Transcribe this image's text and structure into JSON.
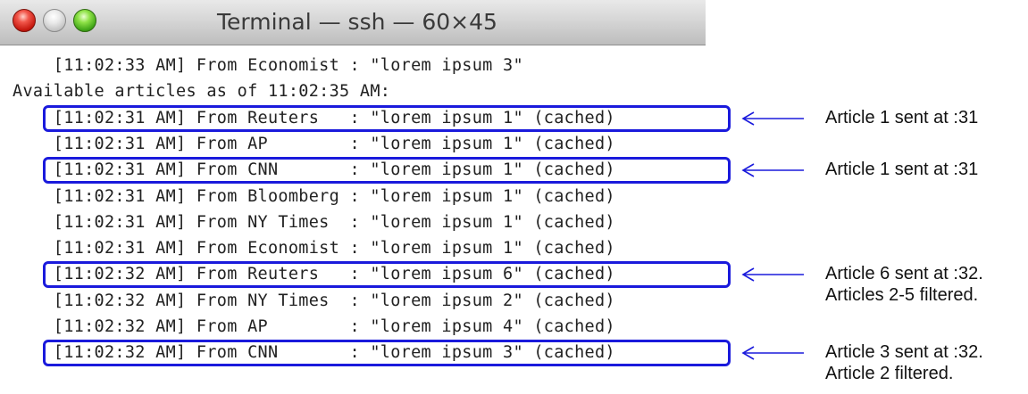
{
  "window": {
    "title": "Terminal — ssh — 60×45",
    "controls": [
      "close-button",
      "minimize-button",
      "zoom-button"
    ]
  },
  "terminal": {
    "lines": [
      "    [11:02:33 AM] From Economist : \"lorem ipsum 3\"",
      "Available articles as of 11:02:35 AM:",
      "    [11:02:31 AM] From Reuters   : \"lorem ipsum 1\" (cached)",
      "    [11:02:31 AM] From AP        : \"lorem ipsum 1\" (cached)",
      "    [11:02:31 AM] From CNN       : \"lorem ipsum 1\" (cached)",
      "    [11:02:31 AM] From Bloomberg : \"lorem ipsum 1\" (cached)",
      "    [11:02:31 AM] From NY Times  : \"lorem ipsum 1\" (cached)",
      "    [11:02:31 AM] From Economist : \"lorem ipsum 1\" (cached)",
      "    [11:02:32 AM] From Reuters   : \"lorem ipsum 6\" (cached)",
      "    [11:02:32 AM] From NY Times  : \"lorem ipsum 2\" (cached)",
      "    [11:02:32 AM] From AP        : \"lorem ipsum 4\" (cached)",
      "    [11:02:32 AM] From CNN       : \"lorem ipsum 3\" (cached)"
    ]
  },
  "annotations": [
    {
      "line": 2,
      "text": "Article 1 sent at :31"
    },
    {
      "line": 4,
      "text": "Article 1 sent at :31"
    },
    {
      "line": 8,
      "text": "Article 6 sent at :32.\nArticles 2-5 filtered."
    },
    {
      "line": 11,
      "text": "Article 3 sent at :32.\nArticle 2 filtered."
    }
  ],
  "colors": {
    "highlight": "#1a1adc",
    "text": "#222222",
    "close": "#e0443a",
    "minimize": "#d0d0d0",
    "zoom": "#5cc52a"
  }
}
